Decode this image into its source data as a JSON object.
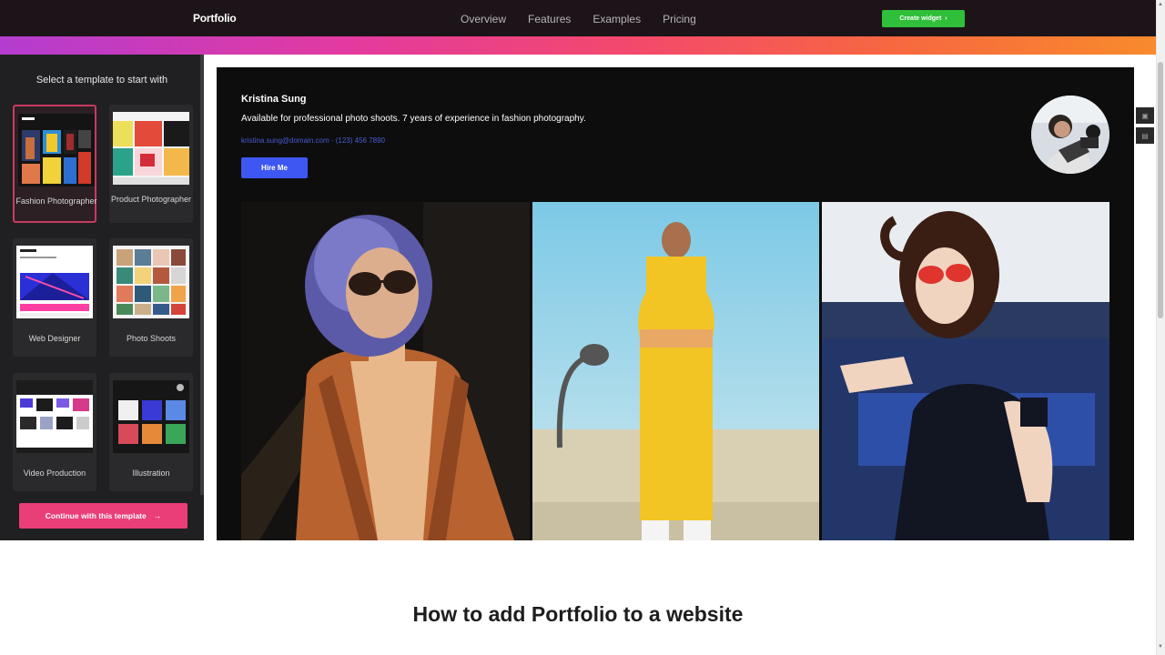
{
  "header": {
    "brand": "Portfolio",
    "nav": [
      "Overview",
      "Features",
      "Examples",
      "Pricing"
    ],
    "cta_label": "Create widget"
  },
  "panel": {
    "title": "Select a template to start with",
    "templates": [
      {
        "label": "Fashion Photographer",
        "selected": true
      },
      {
        "label": "Product Photographer",
        "selected": false
      },
      {
        "label": "Web Designer",
        "selected": false
      },
      {
        "label": "Photo Shoots",
        "selected": false
      },
      {
        "label": "Video Production",
        "selected": false
      },
      {
        "label": "Illustration",
        "selected": false
      }
    ],
    "continue_label": "Continue with this template",
    "continue_arrow": "→"
  },
  "preview": {
    "name": "Kristina Sung",
    "description": "Available for professional photo shoots. 7 years of experience in fashion photography.",
    "contact": "kristina.sung@domain.com  ·  (123) 456 7890",
    "hire_label": "Hire Me"
  },
  "section": {
    "heading": "How to add Portfolio to a website"
  },
  "colors": {
    "accent_pink": "#ea3e78",
    "accent_green": "#2fbf3a",
    "accent_blue": "#3e57f2"
  },
  "icons": [
    "chevron-icon",
    "arrow-right-icon",
    "avatar-photo",
    "scroll-up-icon",
    "scroll-down-icon"
  ]
}
